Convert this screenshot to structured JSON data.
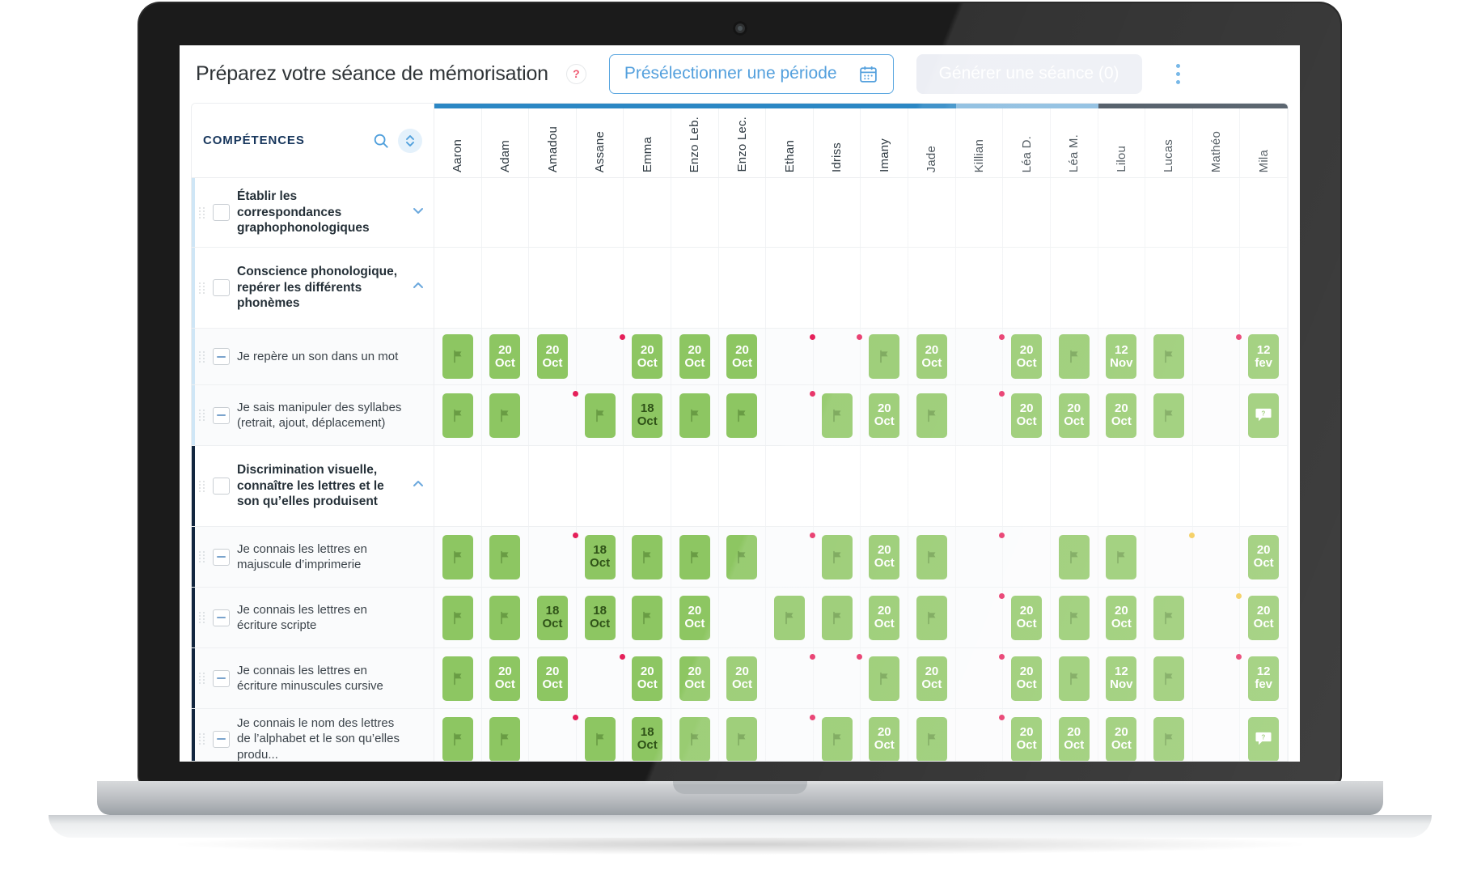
{
  "header": {
    "title": "Préparez votre séance de mémorisation",
    "help_label": "?",
    "period_button": "Présélectionner une période",
    "calendar_icon": "calendar-icon",
    "generate_button": "Générer une séance (0)",
    "menu_icon": "kebab-menu-icon"
  },
  "table": {
    "competences_header": "COMPÉTENCES",
    "search_icon": "search-icon",
    "sort_icon": "sort-updown-icon",
    "students": [
      "Aaron",
      "Adam",
      "Amadou",
      "Assane",
      "Emma",
      "Enzo Leb.",
      "Enzo Lec.",
      "Ethan",
      "Idriss",
      "Imany",
      "Jade",
      "Killian",
      "Léa D.",
      "Léa M.",
      "Lilou",
      "Lucas",
      "Mathéo",
      "Mila"
    ],
    "rows": [
      {
        "label": "Établir les correspondances graphophonologiques",
        "type": "group",
        "accent": "lightblue",
        "checkbox": "empty",
        "caret": "down",
        "cells": []
      },
      {
        "label": "Conscience phonologique, repérer les différents phonèmes",
        "type": "group",
        "accent": "lightblue",
        "checkbox": "empty",
        "caret": "up",
        "cells": []
      },
      {
        "label": "Je repère un son dans un mot",
        "type": "leaf",
        "accent": "lightblue",
        "checkbox": "minus",
        "caret": "none",
        "cells": [
          {
            "kind": "flag"
          },
          {
            "kind": "date",
            "day": "20",
            "month": "Oct"
          },
          {
            "kind": "date",
            "day": "20",
            "month": "Oct"
          },
          {
            "kind": "empty",
            "dot": "red"
          },
          {
            "kind": "date",
            "day": "20",
            "month": "Oct"
          },
          {
            "kind": "date",
            "day": "20",
            "month": "Oct"
          },
          {
            "kind": "date",
            "day": "20",
            "month": "Oct"
          },
          {
            "kind": "empty",
            "dot": "red"
          },
          {
            "kind": "empty",
            "dot": "red"
          },
          {
            "kind": "flag"
          },
          {
            "kind": "date",
            "day": "20",
            "month": "Oct"
          },
          {
            "kind": "empty",
            "dot": "red"
          },
          {
            "kind": "date",
            "day": "20",
            "month": "Oct"
          },
          {
            "kind": "flag"
          },
          {
            "kind": "date",
            "day": "12",
            "month": "Nov"
          },
          {
            "kind": "flag"
          },
          {
            "kind": "empty",
            "dot": "red"
          },
          {
            "kind": "date",
            "day": "12",
            "month": "fev"
          }
        ]
      },
      {
        "label": "Je sais manipuler des syllabes (retrait, ajout, déplacement)",
        "type": "leaf",
        "accent": "lightblue",
        "checkbox": "minus",
        "caret": "none",
        "cells": [
          {
            "kind": "flag"
          },
          {
            "kind": "flag"
          },
          {
            "kind": "empty",
            "dot": "red"
          },
          {
            "kind": "flag"
          },
          {
            "kind": "date",
            "day": "18",
            "month": "Oct",
            "style": "dark"
          },
          {
            "kind": "flag"
          },
          {
            "kind": "flag"
          },
          {
            "kind": "empty",
            "dot": "red"
          },
          {
            "kind": "flag"
          },
          {
            "kind": "date",
            "day": "20",
            "month": "Oct"
          },
          {
            "kind": "flag"
          },
          {
            "kind": "empty",
            "dot": "red"
          },
          {
            "kind": "date",
            "day": "20",
            "month": "Oct"
          },
          {
            "kind": "date",
            "day": "20",
            "month": "Oct"
          },
          {
            "kind": "date",
            "day": "20",
            "month": "Oct"
          },
          {
            "kind": "flag"
          },
          {
            "kind": "empty"
          },
          {
            "kind": "bubble"
          }
        ]
      },
      {
        "label": "Discrimination visuelle, connaître les lettres et le son qu’elles produisent",
        "type": "group",
        "accent": "darkblue",
        "checkbox": "empty",
        "caret": "up",
        "cells": []
      },
      {
        "label": "Je connais les lettres en majuscule d’imprimerie",
        "type": "leaf",
        "accent": "darkblue",
        "checkbox": "minus",
        "caret": "none",
        "cells": [
          {
            "kind": "flag"
          },
          {
            "kind": "flag"
          },
          {
            "kind": "empty",
            "dot": "red"
          },
          {
            "kind": "date",
            "day": "18",
            "month": "Oct",
            "style": "dark"
          },
          {
            "kind": "flag"
          },
          {
            "kind": "flag"
          },
          {
            "kind": "flag"
          },
          {
            "kind": "empty",
            "dot": "red"
          },
          {
            "kind": "flag"
          },
          {
            "kind": "date",
            "day": "20",
            "month": "Oct"
          },
          {
            "kind": "flag"
          },
          {
            "kind": "empty",
            "dot": "red"
          },
          {
            "kind": "empty"
          },
          {
            "kind": "flag"
          },
          {
            "kind": "flag"
          },
          {
            "kind": "empty",
            "dot": "yellow"
          },
          {
            "kind": "empty"
          },
          {
            "kind": "date",
            "day": "20",
            "month": "Oct"
          }
        ]
      },
      {
        "label": "Je connais les lettres en écriture scripte",
        "type": "leaf",
        "accent": "darkblue",
        "checkbox": "minus",
        "caret": "none",
        "cells": [
          {
            "kind": "flag"
          },
          {
            "kind": "flag"
          },
          {
            "kind": "date",
            "day": "18",
            "month": "Oct",
            "style": "dark"
          },
          {
            "kind": "date",
            "day": "18",
            "month": "Oct",
            "style": "dark"
          },
          {
            "kind": "flag"
          },
          {
            "kind": "date",
            "day": "20",
            "month": "Oct"
          },
          {
            "kind": "empty"
          },
          {
            "kind": "flag"
          },
          {
            "kind": "flag"
          },
          {
            "kind": "date",
            "day": "20",
            "month": "Oct"
          },
          {
            "kind": "flag"
          },
          {
            "kind": "empty",
            "dot": "red"
          },
          {
            "kind": "date",
            "day": "20",
            "month": "Oct"
          },
          {
            "kind": "flag"
          },
          {
            "kind": "date",
            "day": "20",
            "month": "Oct"
          },
          {
            "kind": "flag"
          },
          {
            "kind": "empty",
            "dot": "yellow"
          },
          {
            "kind": "date",
            "day": "20",
            "month": "Oct"
          }
        ]
      },
      {
        "label": "Je connais les lettres en écriture minuscules cursive",
        "type": "leaf",
        "accent": "darkblue",
        "checkbox": "minus",
        "caret": "none",
        "cells": [
          {
            "kind": "flag"
          },
          {
            "kind": "date",
            "day": "20",
            "month": "Oct"
          },
          {
            "kind": "date",
            "day": "20",
            "month": "Oct"
          },
          {
            "kind": "empty",
            "dot": "red"
          },
          {
            "kind": "date",
            "day": "20",
            "month": "Oct"
          },
          {
            "kind": "date",
            "day": "20",
            "month": "Oct"
          },
          {
            "kind": "date",
            "day": "20",
            "month": "Oct"
          },
          {
            "kind": "empty",
            "dot": "red"
          },
          {
            "kind": "empty",
            "dot": "red"
          },
          {
            "kind": "flag"
          },
          {
            "kind": "date",
            "day": "20",
            "month": "Oct"
          },
          {
            "kind": "empty",
            "dot": "red"
          },
          {
            "kind": "date",
            "day": "20",
            "month": "Oct"
          },
          {
            "kind": "flag"
          },
          {
            "kind": "date",
            "day": "12",
            "month": "Nov"
          },
          {
            "kind": "flag"
          },
          {
            "kind": "empty",
            "dot": "red"
          },
          {
            "kind": "date",
            "day": "12",
            "month": "fev"
          }
        ]
      },
      {
        "label": "Je connais le nom des lettres de l’alphabet et le son qu’elles produ...",
        "type": "leaf",
        "accent": "darkblue",
        "checkbox": "minus",
        "caret": "none",
        "cells": [
          {
            "kind": "flag"
          },
          {
            "kind": "flag"
          },
          {
            "kind": "empty",
            "dot": "red"
          },
          {
            "kind": "flag"
          },
          {
            "kind": "date",
            "day": "18",
            "month": "Oct",
            "style": "dark"
          },
          {
            "kind": "flag"
          },
          {
            "kind": "flag"
          },
          {
            "kind": "empty",
            "dot": "red"
          },
          {
            "kind": "flag"
          },
          {
            "kind": "date",
            "day": "20",
            "month": "Oct"
          },
          {
            "kind": "flag"
          },
          {
            "kind": "empty",
            "dot": "red"
          },
          {
            "kind": "date",
            "day": "20",
            "month": "Oct"
          },
          {
            "kind": "date",
            "day": "20",
            "month": "Oct"
          },
          {
            "kind": "date",
            "day": "20",
            "month": "Oct"
          },
          {
            "kind": "flag"
          },
          {
            "kind": "empty"
          },
          {
            "kind": "bubble"
          }
        ]
      }
    ]
  },
  "colors": {
    "accent_blue": "#4f9fdc",
    "badge_green": "#8dc662",
    "dot_red": "#e5205a",
    "dot_yellow": "#f2c541",
    "dark_navy": "#12263f"
  }
}
